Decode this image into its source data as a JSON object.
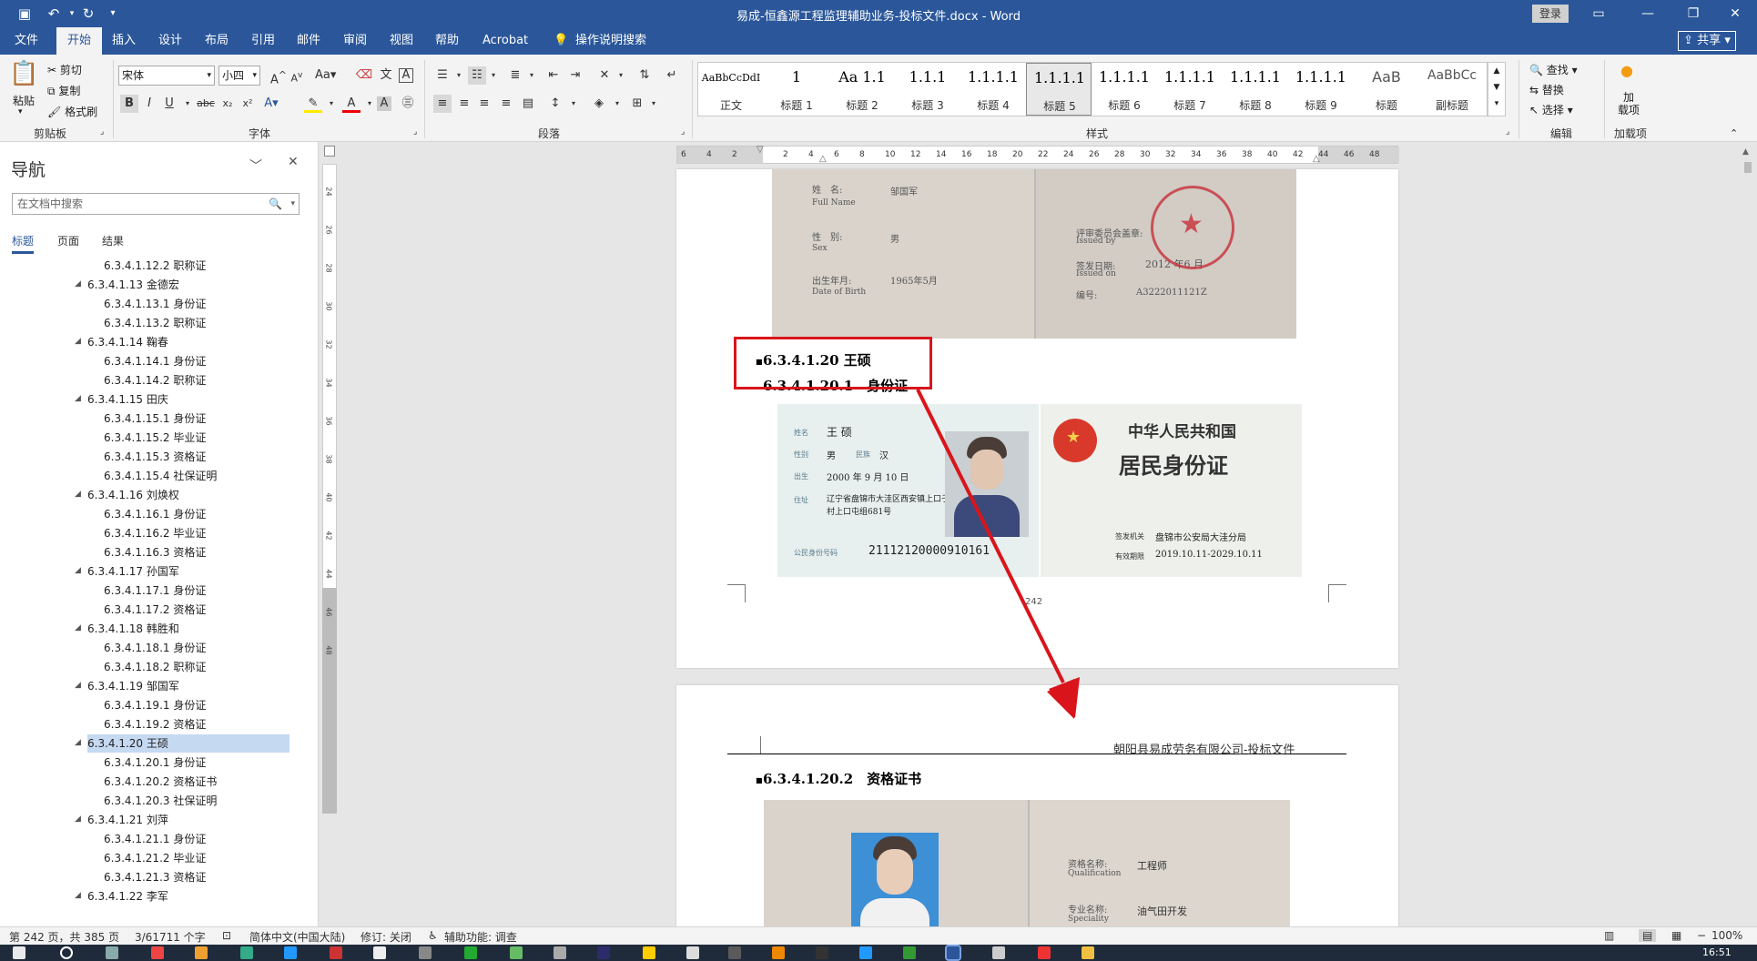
{
  "window": {
    "title": "易成-恒鑫源工程监理辅助业务-投标文件.docx - Word",
    "login_label": "登录",
    "share_label": "共享"
  },
  "tabs": [
    "文件",
    "开始",
    "插入",
    "设计",
    "布局",
    "引用",
    "邮件",
    "审阅",
    "视图",
    "帮助",
    "Acrobat"
  ],
  "tell_me": "操作说明搜索",
  "ribbon": {
    "clipboard": {
      "paste": "粘贴",
      "cut": "剪切",
      "copy": "复制",
      "format_painter": "格式刷",
      "label": "剪贴板"
    },
    "font": {
      "name": "宋体",
      "size": "小四",
      "label": "字体"
    },
    "paragraph": {
      "label": "段落"
    },
    "styles": {
      "label": "样式",
      "items": [
        {
          "preview": "AaBbCcDdI",
          "name": "正文"
        },
        {
          "preview": "1",
          "name": "标题 1"
        },
        {
          "preview": "Aa 1.1",
          "name": "标题 2"
        },
        {
          "preview": "1.1.1",
          "name": "标题 3"
        },
        {
          "preview": "1.1.1.1",
          "name": "标题 4"
        },
        {
          "preview": "1.1.1.1",
          "name": "标题 5"
        },
        {
          "preview": "1.1.1.1",
          "name": "标题 6"
        },
        {
          "preview": "1.1.1.1",
          "name": "标题 7"
        },
        {
          "preview": "1.1.1.1",
          "name": "标题 8"
        },
        {
          "preview": "1.1.1.1",
          "name": "标题 9"
        },
        {
          "preview": "AaB",
          "name": "标题"
        },
        {
          "preview": "AaBbCc",
          "name": "副标题"
        }
      ]
    },
    "editing": {
      "find": "查找",
      "replace": "替换",
      "select": "选择",
      "label": "编辑"
    },
    "addins": {
      "addin": "加\n载项",
      "label": "加载项"
    }
  },
  "nav": {
    "title": "导航",
    "search_placeholder": "在文档中搜索",
    "tabs": [
      "标题",
      "页面",
      "结果"
    ],
    "items": [
      {
        "t": "6.3.4.1.12.2 职称证",
        "l": 2
      },
      {
        "t": "6.3.4.1.13 金德宏",
        "l": 1
      },
      {
        "t": "6.3.4.1.13.1 身份证",
        "l": 2
      },
      {
        "t": "6.3.4.1.13.2 职称证",
        "l": 2
      },
      {
        "t": "6.3.4.1.14 鞠春",
        "l": 1
      },
      {
        "t": "6.3.4.1.14.1 身份证",
        "l": 2
      },
      {
        "t": "6.3.4.1.14.2 职称证",
        "l": 2
      },
      {
        "t": "6.3.4.1.15 田庆",
        "l": 1
      },
      {
        "t": "6.3.4.1.15.1 身份证",
        "l": 2
      },
      {
        "t": "6.3.4.1.15.2 毕业证",
        "l": 2
      },
      {
        "t": "6.3.4.1.15.3 资格证",
        "l": 2
      },
      {
        "t": "6.3.4.1.15.4 社保证明",
        "l": 2
      },
      {
        "t": "6.3.4.1.16 刘焕权",
        "l": 1
      },
      {
        "t": "6.3.4.1.16.1 身份证",
        "l": 2
      },
      {
        "t": "6.3.4.1.16.2 毕业证",
        "l": 2
      },
      {
        "t": "6.3.4.1.16.3 资格证",
        "l": 2
      },
      {
        "t": "6.3.4.1.17 孙国军",
        "l": 1
      },
      {
        "t": "6.3.4.1.17.1 身份证",
        "l": 2
      },
      {
        "t": "6.3.4.1.17.2 资格证",
        "l": 2
      },
      {
        "t": "6.3.4.1.18 韩胜和",
        "l": 1
      },
      {
        "t": "6.3.4.1.18.1 身份证",
        "l": 2
      },
      {
        "t": "6.3.4.1.18.2 职称证",
        "l": 2
      },
      {
        "t": "6.3.4.1.19 邹国军",
        "l": 1
      },
      {
        "t": "6.3.4.1.19.1 身份证",
        "l": 2
      },
      {
        "t": "6.3.4.1.19.2 资格证",
        "l": 2
      },
      {
        "t": "6.3.4.1.20 王硕",
        "l": 1,
        "sel": true
      },
      {
        "t": "6.3.4.1.20.1 身份证",
        "l": 2
      },
      {
        "t": "6.3.4.1.20.2 资格证书",
        "l": 2
      },
      {
        "t": "6.3.4.1.20.3 社保证明",
        "l": 2
      },
      {
        "t": "6.3.4.1.21 刘萍",
        "l": 1
      },
      {
        "t": "6.3.4.1.21.1 身份证",
        "l": 2
      },
      {
        "t": "6.3.4.1.21.2 毕业证",
        "l": 2
      },
      {
        "t": "6.3.4.1.21.3 资格证",
        "l": 2
      },
      {
        "t": "6.3.4.1.22 李军",
        "l": 1
      }
    ]
  },
  "hruler_ticks": [
    "6",
    "4",
    "2",
    "",
    "2",
    "4",
    "6",
    "8",
    "10",
    "12",
    "14",
    "16",
    "18",
    "20",
    "22",
    "24",
    "26",
    "28",
    "30",
    "32",
    "34",
    "36",
    "38",
    "40",
    "42",
    "44",
    "46",
    "48"
  ],
  "vruler_ticks": [
    "24",
    "26",
    "28",
    "30",
    "32",
    "34",
    "36",
    "38",
    "40",
    "42",
    "44",
    "46",
    "48"
  ],
  "doc": {
    "cert1": {
      "name_label": "姓　名:",
      "name_en": "Full Name",
      "name_val": "邹国军",
      "sex_label": "性　别:",
      "sex_en": "Sex",
      "sex_val": "男",
      "birth_label": "出生年月:",
      "birth_en": "Date of Birth",
      "birth_val": "1965年5月",
      "issuer_label": "评审委员会盖章:",
      "issuer_en": "Issued by",
      "date_label": "签发日期:",
      "date_en": "Issued on",
      "date_val": "2012 年6 月",
      "no_label": "编号:",
      "no_val": "A3222011121Z"
    },
    "heading1": "6.3.4.1.20 王硕",
    "heading2": "6.3.4.1.20.1　身份证",
    "id_front": {
      "name_label": "姓名",
      "name": "王 硕",
      "sex_label": "性别",
      "sex": "男",
      "nation_label": "民族",
      "nation": "汉",
      "birth_label": "出生",
      "birth": "2000 年 9 月 10 日",
      "addr_label": "住址",
      "addr": "辽宁省盘锦市大洼区西安镇上口子村上口屯组681号",
      "id_label": "公民身份号码",
      "id": "21112120000910161"
    },
    "id_back": {
      "line1": "中华人民共和国",
      "line2": "居民身份证",
      "authority_label": "签发机关",
      "authority": "盘锦市公安局大洼分局",
      "valid_label": "有效期限",
      "valid": "2019.10.11-2029.10.11"
    },
    "page_number": "242",
    "header_text": "朝阳县易成劳务有限公司-投标文件",
    "heading3": "6.3.4.1.20.2　资格证书",
    "cert2": {
      "qual_label": "资格名称:",
      "qual_en": "Qualification",
      "qual_val": "工程师",
      "spec_label": "专业名称:",
      "spec_en": "Speciality",
      "spec_val": "油气田开发"
    }
  },
  "status": {
    "page": "第 242 页，共 385 页",
    "words": "3/61711 个字",
    "lang": "简体中文(中国大陆)",
    "track": "修订: 关闭",
    "access": "辅助功能: 调查",
    "zoom": "100%"
  },
  "clock": "16:51",
  "colors": {
    "accent": "#2b579a",
    "annotation": "#d9151b"
  }
}
